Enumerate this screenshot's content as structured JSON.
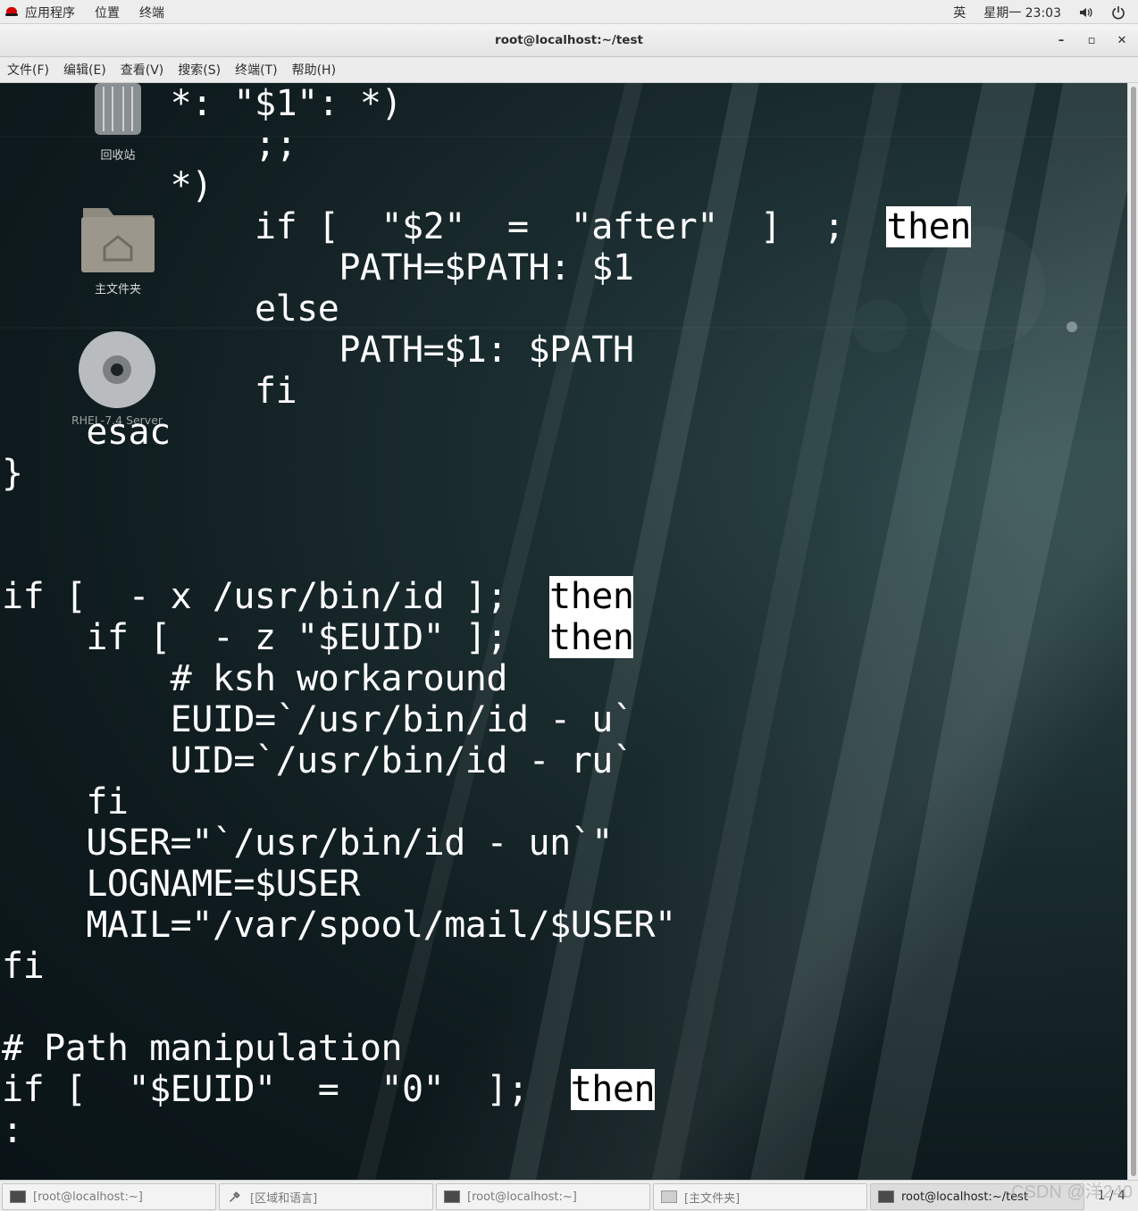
{
  "top_panel": {
    "menus": [
      "应用程序",
      "位置",
      "终端"
    ],
    "lang": "英",
    "clock": "星期一 23:03"
  },
  "window": {
    "title": "root@localhost:~/test",
    "minimize": "–",
    "maximize": "▫",
    "close": "✕"
  },
  "menubar": [
    "文件(F)",
    "编辑(E)",
    "查看(V)",
    "搜索(S)",
    "终端(T)",
    "帮助(H)"
  ],
  "desktop_icons": [
    {
      "label": "回收站",
      "icon": "trash-icon"
    },
    {
      "label": "主文件夹",
      "icon": "home-folder-icon"
    },
    {
      "label": "RHEL-7.4 Server",
      "icon": "disc-icon"
    }
  ],
  "terminal_lines": [
    {
      "text": "        *: \"$1\": *)"
    },
    {
      "text": "            ;;"
    },
    {
      "text": "        *)"
    },
    {
      "text": "            if [  \"$2\"  =  \"after\"  ]  ;  ",
      "hl": "then"
    },
    {
      "text": "                PATH=$PATH: $1"
    },
    {
      "text": "            else"
    },
    {
      "text": "                PATH=$1: $PATH"
    },
    {
      "text": "            fi"
    },
    {
      "text": "    esac"
    },
    {
      "text": "}"
    },
    {
      "text": ""
    },
    {
      "text": ""
    },
    {
      "text": "if [  - x /usr/bin/id ];  ",
      "hl": "then"
    },
    {
      "text": "    if [  - z \"$EUID\" ];  ",
      "hl": "then"
    },
    {
      "text": "        # ksh workaround"
    },
    {
      "text": "        EUID=`/usr/bin/id - u`"
    },
    {
      "text": "        UID=`/usr/bin/id - ru`"
    },
    {
      "text": "    fi"
    },
    {
      "text": "    USER=\"`/usr/bin/id - un`\""
    },
    {
      "text": "    LOGNAME=$USER"
    },
    {
      "text": "    MAIL=\"/var/spool/mail/$USER\""
    },
    {
      "text": "fi"
    },
    {
      "text": ""
    },
    {
      "text": "# Path manipulation"
    },
    {
      "text": "if [  \"$EUID\"  =  \"0\"  ];  ",
      "hl": "then"
    },
    {
      "text": ":"
    }
  ],
  "taskbar": {
    "tasks": [
      {
        "label": "[root@localhost:~]",
        "icon": "terminal-icon"
      },
      {
        "label": "[区域和语言]",
        "icon": "tools-icon"
      },
      {
        "label": "[root@localhost:~]",
        "icon": "terminal-icon"
      },
      {
        "label": "[主文件夹]",
        "icon": "folder-icon"
      },
      {
        "label": "root@localhost:~/test",
        "icon": "terminal-icon",
        "active": true
      }
    ],
    "pager": "1 / 4"
  },
  "watermark": "CSDN @洋240"
}
